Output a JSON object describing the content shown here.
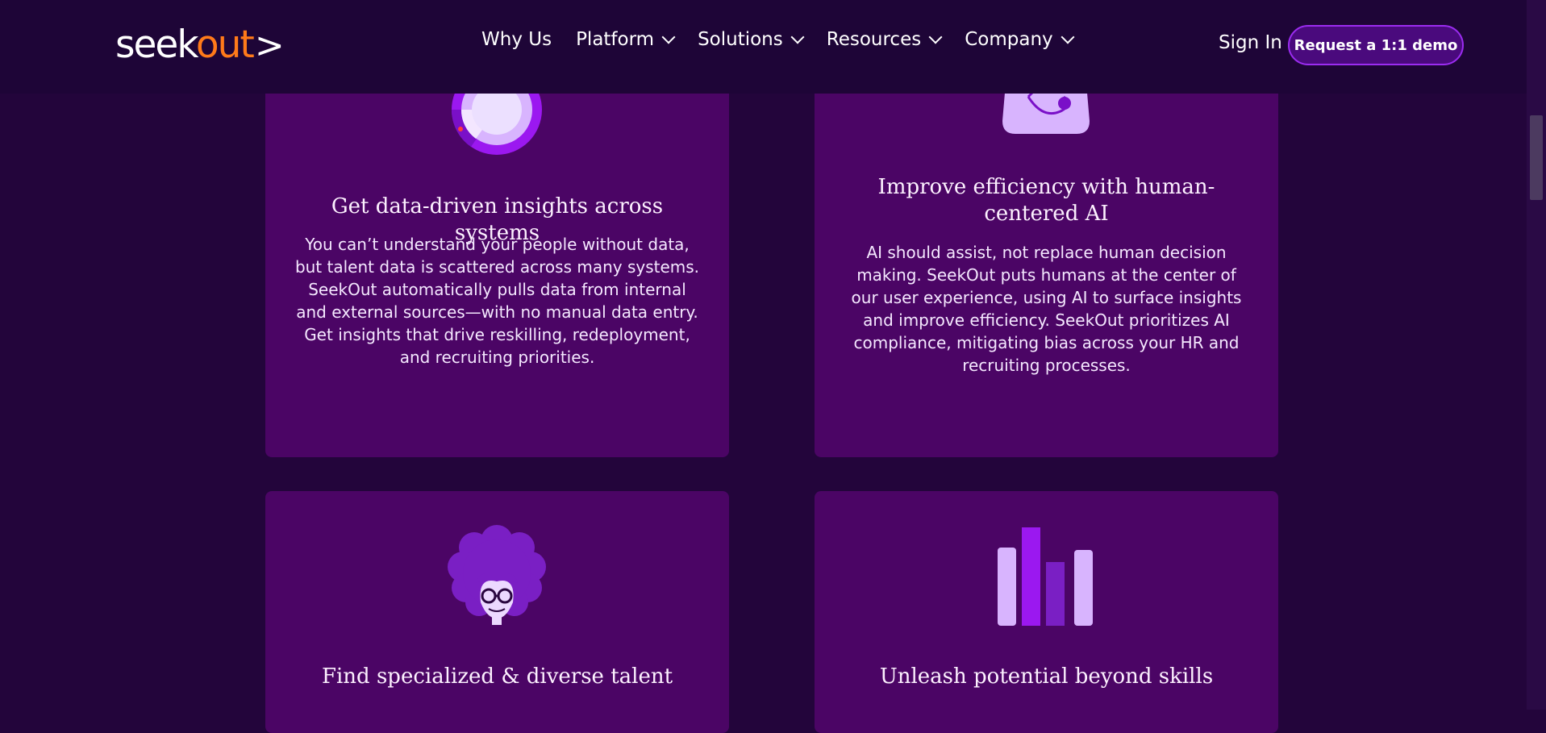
{
  "logo": {
    "seek": "seek",
    "out": "out",
    "chevron": ">"
  },
  "nav": {
    "items": [
      {
        "label": "Why Us",
        "dropdown": false
      },
      {
        "label": "Platform",
        "dropdown": true
      },
      {
        "label": "Solutions",
        "dropdown": true
      },
      {
        "label": "Resources",
        "dropdown": true
      },
      {
        "label": "Company",
        "dropdown": true
      }
    ],
    "sign_in": "Sign In",
    "demo_button": "Request a 1:1 demo"
  },
  "cards": [
    {
      "icon": "donut-chart-icon",
      "title": "Get data-driven insights across systems",
      "body": "You can’t understand your people without data, but talent data is scattered across many systems. SeekOut automatically pulls data from internal and external sources—with no manual data entry. Get insights that drive reskilling, redeployment, and recruiting priorities."
    },
    {
      "icon": "ai-device-icon",
      "title": "Improve efficiency with human-centered AI",
      "body": "AI should assist, not replace human decision making. SeekOut puts humans at the center of our user experience, using AI to surface insights and improve efficiency. SeekOut prioritizes AI compliance, mitigating bias across your HR and recruiting processes."
    },
    {
      "icon": "person-avatar-icon",
      "title": "Find specialized & diverse talent",
      "body": ""
    },
    {
      "icon": "bar-chart-icon",
      "title": "Unleash potential beyond skills",
      "body": ""
    }
  ],
  "colors": {
    "page_bg": "#23053b",
    "header_bg": "#1e0537",
    "card_bg": "#4b0565",
    "accent_orange": "#ff7a1a",
    "accent_purple": "#9b2cf0"
  }
}
